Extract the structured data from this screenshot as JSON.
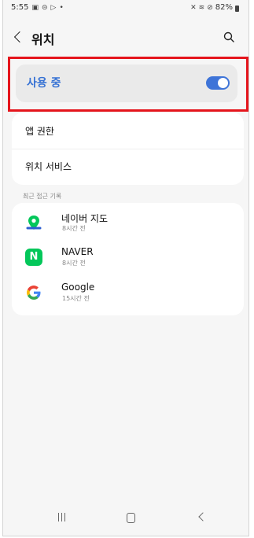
{
  "status_bar": {
    "time": "5:55",
    "battery": "82%"
  },
  "header": {
    "title": "위치"
  },
  "location_toggle": {
    "label": "사용 중",
    "state": "on"
  },
  "settings": {
    "items": [
      {
        "label": "앱 권한"
      },
      {
        "label": "위치 서비스"
      }
    ]
  },
  "recent": {
    "header": "최근 접근 기록",
    "apps": [
      {
        "name": "네이버 지도",
        "time": "8시간 전",
        "icon": "naver-map-icon"
      },
      {
        "name": "NAVER",
        "time": "8시간 전",
        "icon": "naver-icon"
      },
      {
        "name": "Google",
        "time": "15시간 전",
        "icon": "google-icon"
      }
    ]
  },
  "colors": {
    "accent": "#3e74d8",
    "highlight": "#e5151c",
    "naver_green": "#03c75a"
  }
}
